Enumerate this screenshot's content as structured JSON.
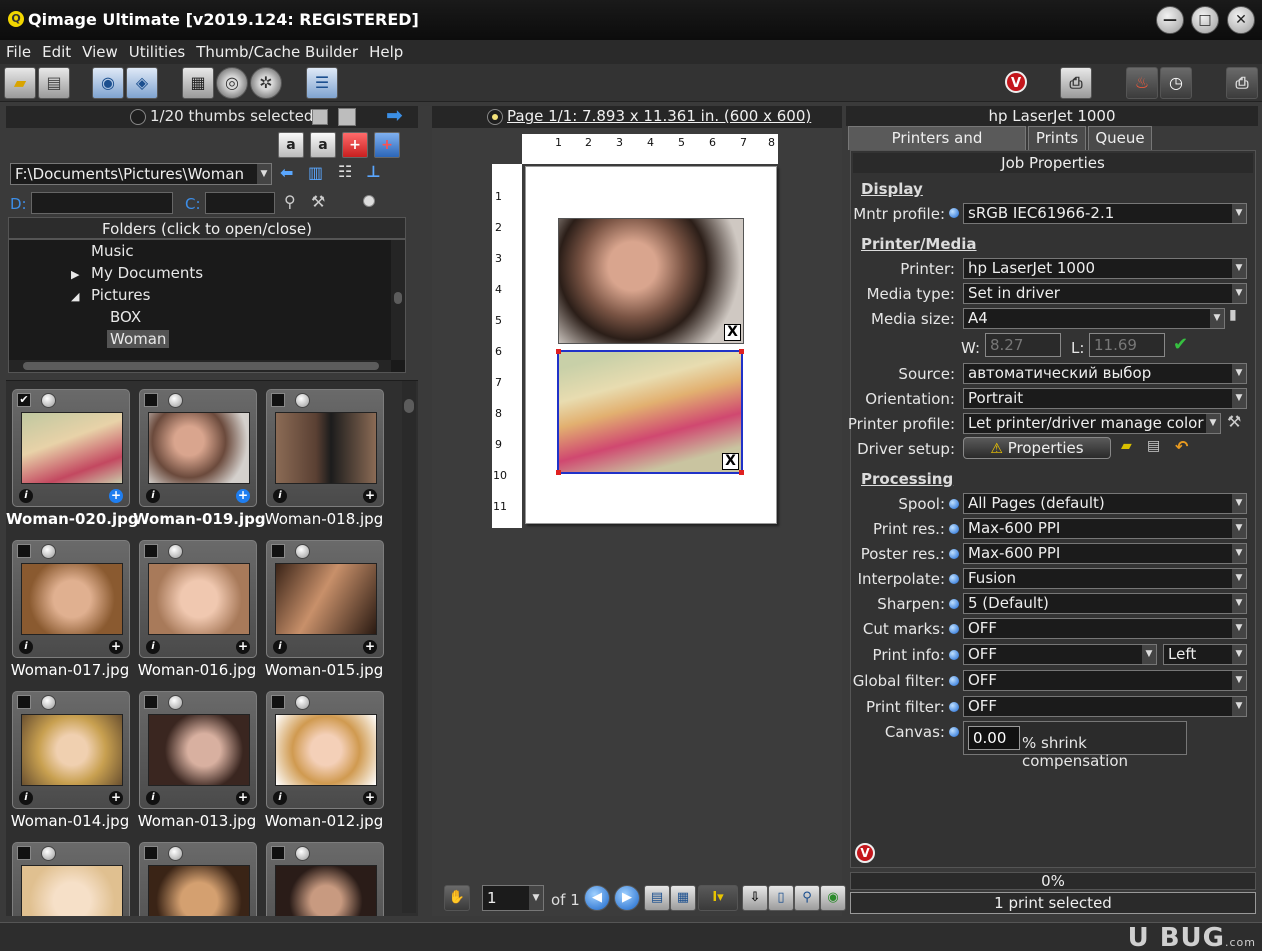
{
  "window": {
    "title": "Qimage Ultimate [v2019.124: REGISTERED]",
    "app_icon": "Q",
    "minimize": "—",
    "maximize": "□",
    "close": "✕"
  },
  "menu": [
    "File",
    "Edit",
    "View",
    "Utilities",
    "Thumb/Cache Builder",
    "Help"
  ],
  "left": {
    "selection_status": "1/20 thumbs selected",
    "path": "F:\\Documents\\Pictures\\Woman",
    "drive_label": "D:",
    "cache_label": "C:",
    "folders_title": "Folders (click to open/close)",
    "folders": [
      {
        "name": "Music",
        "arrow": ""
      },
      {
        "name": "My Documents",
        "arrow": "▶"
      },
      {
        "name": "Pictures",
        "arrow": "◢"
      },
      {
        "name": "BOX",
        "arrow": ""
      },
      {
        "name": "Woman",
        "arrow": ""
      }
    ],
    "thumbnails": [
      {
        "name": "Woman-020.jpg",
        "checked": true,
        "bold": true,
        "blue": true
      },
      {
        "name": "Woman-019.jpg",
        "checked": false,
        "bold": true,
        "blue": true
      },
      {
        "name": "Woman-018.jpg",
        "checked": false,
        "bold": false,
        "blue": false
      },
      {
        "name": "Woman-017.jpg",
        "checked": false,
        "bold": false,
        "blue": false
      },
      {
        "name": "Woman-016.jpg",
        "checked": false,
        "bold": false,
        "blue": false
      },
      {
        "name": "Woman-015.jpg",
        "checked": false,
        "bold": false,
        "blue": false
      },
      {
        "name": "Woman-014.jpg",
        "checked": false,
        "bold": false,
        "blue": false
      },
      {
        "name": "Woman-013.jpg",
        "checked": false,
        "bold": false,
        "blue": false
      },
      {
        "name": "Woman-012.jpg",
        "checked": false,
        "bold": false,
        "blue": false
      },
      {
        "name": "",
        "checked": false,
        "bold": false,
        "blue": false
      },
      {
        "name": "",
        "checked": false,
        "bold": false,
        "blue": false
      },
      {
        "name": "",
        "checked": false,
        "bold": false,
        "blue": false
      }
    ]
  },
  "center": {
    "page_label": "Page 1/1: 7.893 x 11.361 in.  (600 x 600)",
    "ruler_top": [
      "1",
      "2",
      "3",
      "4",
      "5",
      "6",
      "7",
      "8"
    ],
    "ruler_left": [
      "1",
      "2",
      "3",
      "4",
      "5",
      "6",
      "7",
      "8",
      "9",
      "10",
      "11"
    ],
    "page_number": "1",
    "of_label": "of 1",
    "image_close": "X"
  },
  "right": {
    "printer_title": "hp LaserJet 1000",
    "tabs": [
      "Printers and Settings*",
      "Prints",
      "Queue"
    ],
    "job_title": "Job Properties",
    "section_display": "Display",
    "section_printer": "Printer/Media",
    "section_processing": "Processing",
    "props": {
      "monitor_profile": {
        "label": "Mntr profile:",
        "value": "sRGB IEC61966-2.1"
      },
      "printer": {
        "label": "Printer:",
        "value": "hp LaserJet 1000"
      },
      "media_type": {
        "label": "Media type:",
        "value": "Set in driver"
      },
      "media_size": {
        "label": "Media size:",
        "value": "A4"
      },
      "source": {
        "label": "Source:",
        "value": "автоматический выбор"
      },
      "orientation": {
        "label": "Orientation:",
        "value": "Portrait"
      },
      "printer_profile": {
        "label": "Printer profile:",
        "value": "Let printer/driver manage color"
      },
      "driver_setup": {
        "label": "Driver setup:",
        "value": "Properties"
      },
      "spool": {
        "label": "Spool:",
        "value": "All Pages (default)"
      },
      "print_res": {
        "label": "Print res.:",
        "value": "Max-600 PPI"
      },
      "poster_res": {
        "label": "Poster res.:",
        "value": "Max-600 PPI"
      },
      "interpolate": {
        "label": "Interpolate:",
        "value": "Fusion"
      },
      "sharpen": {
        "label": "Sharpen:",
        "value": "5 (Default)"
      },
      "cut_marks": {
        "label": "Cut marks:",
        "value": "OFF"
      },
      "print_info": {
        "label": "Print info:",
        "value": "OFF",
        "position": "Left"
      },
      "global_filter": {
        "label": "Global filter:",
        "value": "OFF"
      },
      "print_filter": {
        "label": "Print filter:",
        "value": "OFF"
      },
      "canvas": {
        "label": "Canvas:",
        "value": "0.00",
        "suffix": "% shrink compensation"
      }
    },
    "width_label": "W:",
    "width_value": "8.27",
    "length_label": "L:",
    "length_value": "11.69",
    "progress": "0%",
    "status": "1 print selected"
  },
  "watermark": {
    "text": "U BUG",
    "sub": ".com"
  }
}
